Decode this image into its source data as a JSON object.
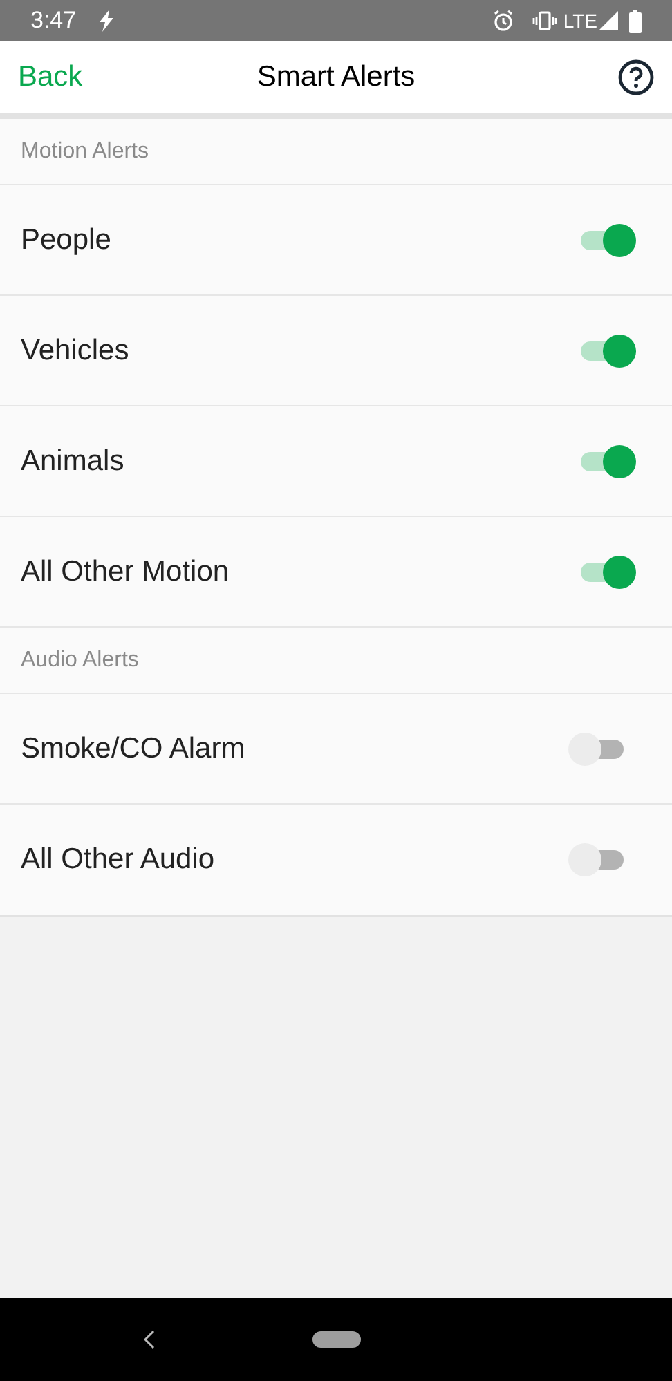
{
  "status_bar": {
    "time": "3:47",
    "network": "LTE"
  },
  "header": {
    "back": "Back",
    "title": "Smart Alerts"
  },
  "sections": [
    {
      "title": "Motion Alerts",
      "items": [
        {
          "label": "People",
          "on": true
        },
        {
          "label": "Vehicles",
          "on": true
        },
        {
          "label": "Animals",
          "on": true
        },
        {
          "label": "All Other Motion",
          "on": true
        }
      ]
    },
    {
      "title": "Audio Alerts",
      "items": [
        {
          "label": "Smoke/CO Alarm",
          "on": false
        },
        {
          "label": "All Other Audio",
          "on": false
        }
      ]
    }
  ]
}
